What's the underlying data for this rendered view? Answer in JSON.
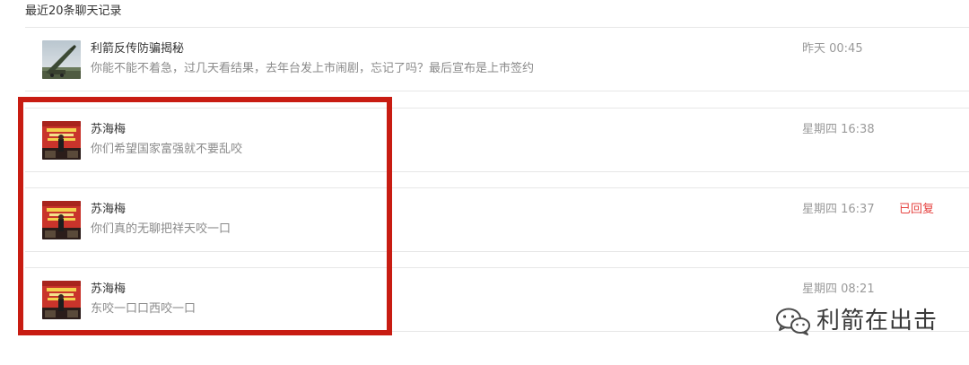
{
  "section": {
    "title": "最近20条聊天记录"
  },
  "messages": [
    {
      "nickname": "利箭反传防骗揭秘",
      "text": "你能不能不着急，过几天看结果，去年台发上市闹剧，忘记了吗？最后宣布是上市签约",
      "time": "昨天 00:45",
      "status": "",
      "avatar": "missile-photo-avatar"
    },
    {
      "nickname": "苏海梅",
      "text": "你们希望国家富强就不要乱咬",
      "time": "星期四 16:38",
      "status": "",
      "avatar": "red-stage-photo-avatar"
    },
    {
      "nickname": "苏海梅",
      "text": "你们真的无聊把祥天咬一口",
      "time": "星期四 16:37",
      "status": "已回复",
      "avatar": "red-stage-photo-avatar"
    },
    {
      "nickname": "苏海梅",
      "text": "东咬一口口西咬一口",
      "time": "星期四 08:21",
      "status": "",
      "avatar": "red-stage-photo-avatar"
    }
  ],
  "watermark": {
    "text": "利箭在出击",
    "icon": "wechat-icon"
  },
  "colors": {
    "highlight_border": "#c81c12",
    "status_replied": "#e64340"
  }
}
